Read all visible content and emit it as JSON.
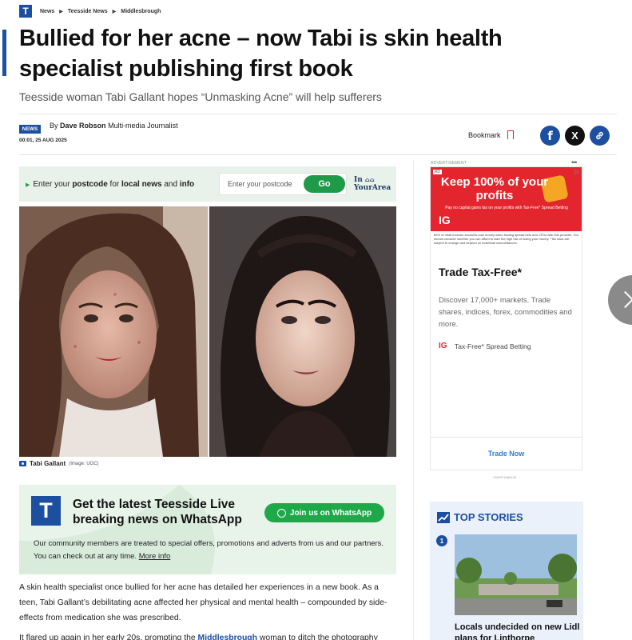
{
  "breadcrumb": {
    "logo_letter": "T",
    "items": [
      "News",
      "Teesside News",
      "Middlesbrough"
    ]
  },
  "article": {
    "headline": "Bullied for her acne – now Tabi is skin health specialist publishing first book",
    "standfirst": "Teesside woman Tabi Gallant hopes “Unmasking Acne” will help sufferers",
    "section_badge": "NEWS",
    "byline_prefix": "By",
    "author": "Dave Robson",
    "author_role": "Multi-media Journalist",
    "dateline": "00:01, 25 AUG 2025",
    "bookmark_label": "Bookmark",
    "photo_caption_name": "Tabi Gallant",
    "photo_caption_credit": "(Image: UGC)",
    "paragraph_1": "A skin health specialist once bullied for her acne has detailed her experiences in a new book. As a teen, Tabi Gallant’s debilitating acne affected her physical and mental health – compounded by side-effects from medication she was prescribed.",
    "paragraph_2_start": "It flared up again in her early 20s, prompting the",
    "paragraph_2_link": "Middlesbrough",
    "paragraph_2_end": "woman to ditch the photography"
  },
  "share": {
    "facebook": "f",
    "x": "X",
    "link": "🔗"
  },
  "postcode": {
    "text_1": "Enter your",
    "text_bold_1": "postcode",
    "text_2": "for",
    "text_bold_2": "local news",
    "text_3": "and",
    "text_bold_3": "info",
    "placeholder": "Enter your postcode",
    "button": "Go",
    "brand_line_1": "In",
    "brand_line_2": "YourArea"
  },
  "promo": {
    "logo_letter": "T",
    "title": "Get the latest Teesside Live breaking news on WhatsApp",
    "button": "Join us on WhatsApp",
    "body": "Our community members are treated to special offers, promotions and adverts from us and our partners. You can check out at any time.",
    "link": "More info"
  },
  "ad": {
    "label": "ADVERTISEMENT",
    "menu": "•••",
    "tag": "AD",
    "headline": "Keep 100% of your profits",
    "small_text": "Pay no capital gains tax on your profits with Tax-Free* Spread Betting",
    "brand": "IG",
    "disclaimer": "69% of retail investor accounts lose money when trading spread bets and CFDs with this provider. You should consider whether you can afford to take the high risk of losing your money. *Tax laws are subject to change and depend on individual circumstances.",
    "title": "Trade Tax-Free*",
    "description": "Discover 17,000+ markets. Trade shares, indices, forex, commodities and more.",
    "product": "Tax-Free* Spread Betting",
    "cta": "Trade Now",
    "id": "1384374485146"
  },
  "top_stories": {
    "heading": "TOP STORIES",
    "items": [
      {
        "rank": "1",
        "title": "Locals undecided on new Lidl plans for Linthorpe"
      }
    ]
  },
  "colors": {
    "brand_blue": "#1d4fa0",
    "whatsapp_green": "#1fa84a",
    "ig_red": "#e3262e",
    "facebook": "#1d4fa0",
    "x": "#111111"
  }
}
